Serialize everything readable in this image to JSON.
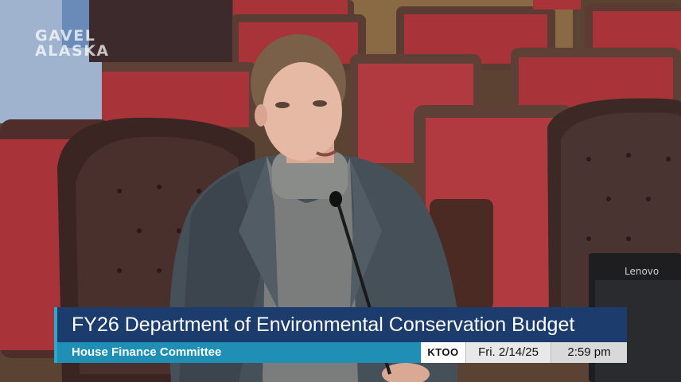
{
  "watermark": {
    "line1": "GAVEL",
    "line2": "ALASKA"
  },
  "monitor_brand": "Lenovo",
  "lower_third": {
    "title": "FY26 Department of Environmental Conservation Budget",
    "committee": "House Finance Committee",
    "station": "KTOO",
    "date": "Fri. 2/14/25",
    "time": "2:59 pm"
  },
  "colors": {
    "title_bar": "#1d3c6e",
    "committee_bar": "#1f8fb5",
    "chair_red": "#a8343a",
    "chair_leather": "#3a2523"
  }
}
